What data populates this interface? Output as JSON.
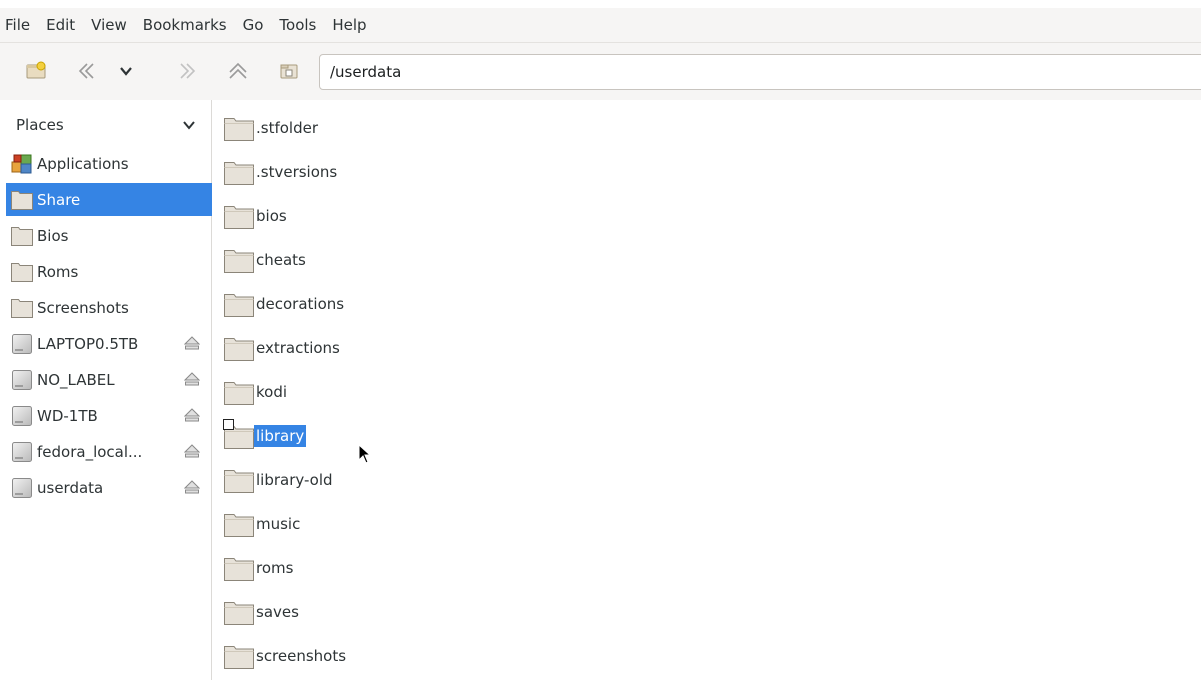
{
  "menubar": {
    "items": [
      "File",
      "Edit",
      "View",
      "Bookmarks",
      "Go",
      "Tools",
      "Help"
    ]
  },
  "toolbar": {
    "buttons": [
      "new-window-icon",
      "back-icon",
      "history-dropdown-icon",
      "forward-icon",
      "up-icon",
      "home-icon"
    ],
    "location": "/userdata"
  },
  "sidebar": {
    "header": "Places",
    "items": [
      {
        "label": "Applications",
        "icon": "applications-icon"
      },
      {
        "label": "Share",
        "icon": "folder-icon",
        "selected": true
      },
      {
        "label": "Bios",
        "icon": "folder-icon"
      },
      {
        "label": "Roms",
        "icon": "folder-icon"
      },
      {
        "label": "Screenshots",
        "icon": "folder-icon"
      },
      {
        "label": "LAPTOP0.5TB",
        "icon": "drive-icon",
        "eject": true
      },
      {
        "label": "NO_LABEL",
        "icon": "drive-icon",
        "eject": true
      },
      {
        "label": "WD-1TB",
        "icon": "drive-icon",
        "eject": true
      },
      {
        "label": "fedora_local...",
        "icon": "drive-icon",
        "eject": true
      },
      {
        "label": "userdata",
        "icon": "drive-icon",
        "eject": true
      }
    ]
  },
  "files": [
    {
      "name": ".stfolder"
    },
    {
      "name": ".stversions"
    },
    {
      "name": "bios"
    },
    {
      "name": "cheats"
    },
    {
      "name": "decorations"
    },
    {
      "name": "extractions"
    },
    {
      "name": "kodi"
    },
    {
      "name": "library",
      "selected": true,
      "symlink": true
    },
    {
      "name": "library-old"
    },
    {
      "name": "music"
    },
    {
      "name": "roms"
    },
    {
      "name": "saves"
    },
    {
      "name": "screenshots"
    }
  ],
  "colors": {
    "selection": "#3584e4",
    "folder_fill": "#e7e2d9",
    "folder_stroke": "#8b8579"
  }
}
